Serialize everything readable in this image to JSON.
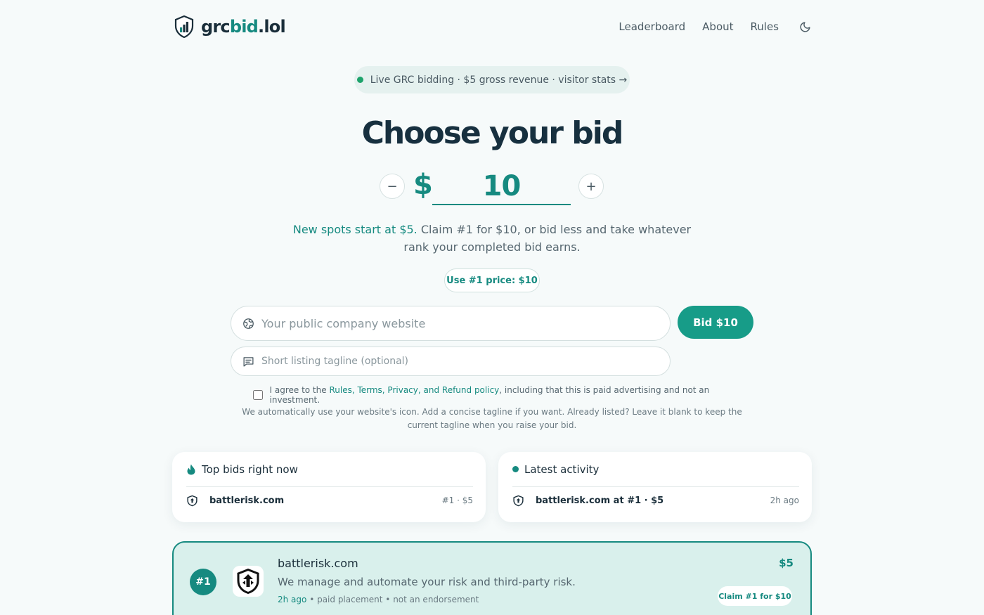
{
  "brand": {
    "name_prefix": "grc",
    "name_accent": "bid",
    "name_suffix": ".lol"
  },
  "nav": {
    "leaderboard": "Leaderboard",
    "about": "About",
    "rules": "Rules"
  },
  "status_pill": {
    "text": "Live GRC bidding · $5 gross revenue · visitor stats →"
  },
  "hero": {
    "title": "Choose your bid"
  },
  "bid": {
    "currency": "$",
    "value": "10",
    "minus": "−",
    "plus": "+"
  },
  "description": {
    "accent": "New spots start at $5.",
    "rest": " Claim #1 for $10, or bid less and take whatever rank your completed bid earns."
  },
  "use_top_price": "Use #1 price: $10",
  "form": {
    "website_placeholder": "Your public company website",
    "tagline_placeholder": "Short listing tagline (optional)",
    "submit": "Bid $10",
    "agree_prefix": "I agree to the ",
    "agree_link": "Rules, Terms, Privacy, and Refund policy",
    "agree_suffix": ", including that this is paid advertising and not an investment.",
    "note": "We automatically use your website's icon. Add a concise tagline if you want. Already listed? Leave it blank to keep the current tagline when you raise your bid."
  },
  "top_bids": {
    "title": "Top bids right now",
    "rows": [
      {
        "name": "battlerisk.com",
        "meta": "#1 · $5"
      }
    ]
  },
  "latest_activity": {
    "title": "Latest activity",
    "rows": [
      {
        "text": "battlerisk.com at #1 · $5",
        "time": "2h ago"
      }
    ]
  },
  "listing": {
    "rank": "#1",
    "name": "battlerisk.com",
    "tagline": "We manage and automate your risk and third-party risk.",
    "time": "2h ago",
    "meta": " • paid placement • not an endorsement",
    "price": "$5",
    "claim": "Claim #1 for $10"
  },
  "colors": {
    "accent": "#168a80",
    "button": "#179c88",
    "background": "#f6fafa",
    "listing_bg": "#d9f0ec",
    "live_dot": "#1ea36c"
  }
}
